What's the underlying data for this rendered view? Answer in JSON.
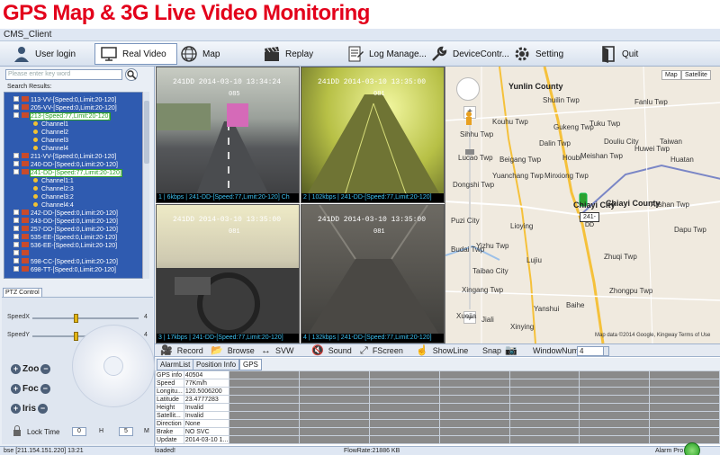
{
  "banner": {
    "title": "GPS Map & 3G Live Video Monitoring"
  },
  "window": {
    "title": "CMS_Client"
  },
  "toolbar": {
    "items": [
      {
        "label": "User login",
        "icon": "user-icon"
      },
      {
        "label": "Real Video",
        "icon": "monitor-icon"
      },
      {
        "label": "Map",
        "icon": "globe-icon"
      },
      {
        "label": "Replay",
        "icon": "clapper-icon"
      },
      {
        "label": "Log Manage...",
        "icon": "document-icon"
      },
      {
        "label": "DeviceContr...",
        "icon": "wrench-icon"
      },
      {
        "label": "Setting",
        "icon": "gear-icon"
      },
      {
        "label": "Quit",
        "icon": "exit-door-icon"
      }
    ]
  },
  "search": {
    "placeholder": "Please enter key word",
    "results_label": "Search Results:"
  },
  "tree": [
    {
      "label": "113-VV-[Speed:0,Limit:20-120]"
    },
    {
      "label": "205-VV-[Speed:0,Limit:20-120]"
    },
    {
      "label": "213-[Speed:77,Limit:20-120]",
      "selected": true
    },
    {
      "label": "Channel1",
      "channel": true
    },
    {
      "label": "Channel2",
      "channel": true
    },
    {
      "label": "Channel3",
      "channel": true
    },
    {
      "label": "Channel4",
      "channel": true
    },
    {
      "label": "211-VV-[Speed:0,Limit:20-120]"
    },
    {
      "label": "240-DD-[Speed:0,Limit:20-120]"
    },
    {
      "label": "241-DD-[Speed:77,Limit:20-120]",
      "selected": true
    },
    {
      "label": "Channel1:1",
      "channel": true
    },
    {
      "label": "Channel2:3",
      "channel": true
    },
    {
      "label": "Channel3:2",
      "channel": true
    },
    {
      "label": "Channel4:4",
      "channel": true
    },
    {
      "label": "242-DD-[Speed:0,Limit:20-120]"
    },
    {
      "label": "243-DD-[Speed:0,Limit:20-120]"
    },
    {
      "label": "257-DD-[Speed:0,Limit:20-120]"
    },
    {
      "label": "535-EE-[Speed:0,Limit:20-120]"
    },
    {
      "label": "536-EE-[Speed:0,Limit:20-120]"
    },
    {
      "label": ""
    },
    {
      "label": "598-CC-[Speed:0,Limit:20-120]"
    },
    {
      "label": "698-TT-[Speed:0,Limit:20-120]"
    }
  ],
  "ptz": {
    "tab": "PTZ Control",
    "speedx_label": "SpeedX",
    "speedx_value": "4",
    "speedy_label": "SpeedY",
    "speedy_value": "4",
    "zoom_label": "Zoo",
    "focus_label": "Foc",
    "iris_label": "Iris",
    "lock_label": "Lock Time",
    "lock_h": "0",
    "h_label": "H",
    "lock_m": "5",
    "m_label": "M"
  },
  "videos": [
    {
      "hud": "241DD  2014-03-10 13:34:24",
      "sub": "085",
      "caption": "1 | 6kbps | 241-DD-[Speed:77,Limit:20-120] Ch"
    },
    {
      "hud": "241DD  2014-03-10 13:35:00",
      "sub": "081",
      "caption": "2 | 102kbps | 241-DD-[Speed:77,Limit:20-120]"
    },
    {
      "hud": "241DD  2014-03-10 13:35:00",
      "sub": "081",
      "caption": "3 | 17kbps | 241-DD-[Speed:77,Limit:20-120]"
    },
    {
      "hud": "241DD  2014-03-10 13:35:00",
      "sub": "081",
      "caption": "4 | 132kbps | 241-DD-[Speed:77,Limit:20-120]"
    }
  ],
  "map": {
    "type_map": "Map",
    "type_sat": "Satellite",
    "car_label": "241-DD",
    "copyright": "Map data ©2014 Google, Kingway  Terms of Use",
    "places": [
      {
        "name": "Yunlin County",
        "big": true
      },
      {
        "name": "Chiayi County",
        "big": true
      },
      {
        "name": "Chiayi City",
        "big": true
      },
      {
        "name": "Shuilin Twp"
      },
      {
        "name": "Kouhu Twp"
      },
      {
        "name": "Sihhu Twp"
      },
      {
        "name": "Yuanchang Twp"
      },
      {
        "name": "Beigang Twp"
      },
      {
        "name": "Dongshi Twp"
      },
      {
        "name": "Budai Twp"
      },
      {
        "name": "Yizhu Twp"
      },
      {
        "name": "Puzi City"
      },
      {
        "name": "Lucao Twp"
      },
      {
        "name": "Taibao City"
      },
      {
        "name": "Xingang Twp"
      },
      {
        "name": "Minxiong Twp"
      },
      {
        "name": "Dalin Twp"
      },
      {
        "name": "Meishan Twp"
      },
      {
        "name": "Zhuqi Twp"
      },
      {
        "name": "Fanlu Twp"
      },
      {
        "name": "Alishan Twp"
      },
      {
        "name": "Zhongpu Twp"
      },
      {
        "name": "Dapu Twp"
      },
      {
        "name": "Xuejia"
      },
      {
        "name": "Jiali"
      },
      {
        "name": "Yanshui"
      },
      {
        "name": "Xinying"
      },
      {
        "name": "Baihe"
      },
      {
        "name": "Houbi"
      },
      {
        "name": "Lioying"
      },
      {
        "name": "Lujiu"
      },
      {
        "name": "Gukeng Twp"
      },
      {
        "name": "Tuku Twp"
      },
      {
        "name": "Douliu City"
      },
      {
        "name": "Huwei Twp"
      },
      {
        "name": "Huatan"
      },
      {
        "name": "Taiwan"
      }
    ]
  },
  "video_toolbar": {
    "record": "Record",
    "browse": "Browse",
    "svw": "SVW",
    "sound": "Sound",
    "fscreen": "FScreen",
    "showline": "ShowLine",
    "snap": "Snap",
    "windownum_label": "WindowNum",
    "windownum_value": "4"
  },
  "info_tabs": [
    "AlarmList",
    "Position Info",
    "GPS"
  ],
  "gps_info": [
    {
      "key": "GPS info",
      "value": "40504"
    },
    {
      "key": "Speed",
      "value": "77Km/h"
    },
    {
      "key": "Longitu...",
      "value": "120.5006200"
    },
    {
      "key": "Latitude",
      "value": "23.4777283"
    },
    {
      "key": "Height",
      "value": "Invalid"
    },
    {
      "key": "Satellit...",
      "value": "Invalid"
    },
    {
      "key": "Direction",
      "value": "None"
    },
    {
      "key": "Brake",
      "value": "NO SVC"
    },
    {
      "key": "Update",
      "value": "2014-03-10 1..."
    }
  ],
  "status": {
    "server": "bse [211.154.151.220]  13:21",
    "state": "loaded!",
    "flowrate": "FlowRate:21886 KB",
    "alarm": "Alarm Pro"
  }
}
